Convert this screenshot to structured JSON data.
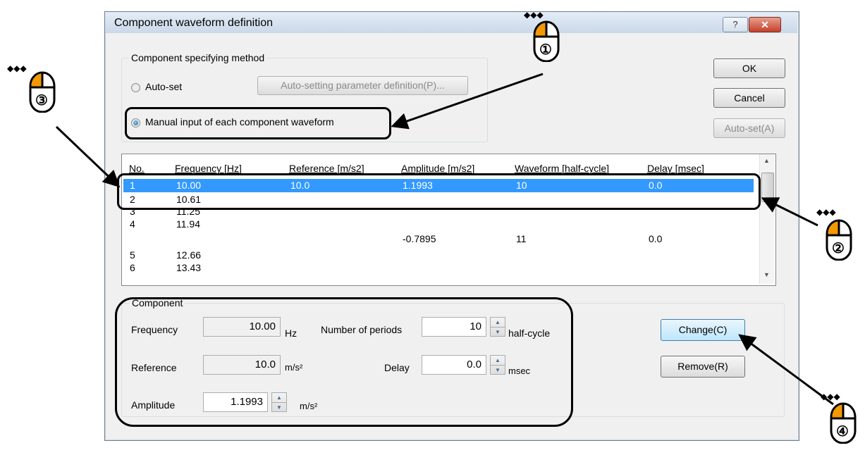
{
  "dialog": {
    "title": "Component waveform definition",
    "help_label": "?",
    "close_label": "✕"
  },
  "method_group": {
    "legend": "Component specifying method",
    "auto_set_label": "Auto-set",
    "auto_param_button": "Auto-setting parameter definition(P)...",
    "manual_label": "Manual input of each component waveform"
  },
  "buttons": {
    "ok": "OK",
    "cancel": "Cancel",
    "auto_set": "Auto-set(A)",
    "change": "Change(C)",
    "remove": "Remove(R)"
  },
  "table": {
    "columns": [
      "No.",
      "Frequency [Hz]",
      "Reference [m/s2]",
      "Amplitude [m/s2]",
      "Waveform [half-cycle]",
      "Delay [msec]"
    ],
    "rows": [
      {
        "no": "1",
        "freq": "10.00",
        "ref": "10.0",
        "amp": "1.1993",
        "wave": "10",
        "delay": "0.0"
      },
      {
        "no": "2",
        "freq": "10.61",
        "ref": "",
        "amp": "",
        "wave": "",
        "delay": ""
      },
      {
        "no": "3",
        "freq": "11.25",
        "ref": "",
        "amp": "",
        "wave": "",
        "delay": ""
      },
      {
        "no": "4",
        "freq": "11.94",
        "ref": "",
        "amp": "-0.7895",
        "wave": "11",
        "delay": "0.0"
      },
      {
        "no": "5",
        "freq": "12.66",
        "ref": "",
        "amp": "",
        "wave": "",
        "delay": ""
      },
      {
        "no": "6",
        "freq": "13.43",
        "ref": "",
        "amp": "",
        "wave": "",
        "delay": ""
      }
    ]
  },
  "component": {
    "legend": "Component",
    "frequency_label": "Frequency",
    "frequency_value": "10.00",
    "frequency_unit": "Hz",
    "periods_label": "Number of periods",
    "periods_value": "10",
    "periods_unit": "half-cycle",
    "reference_label": "Reference",
    "reference_value": "10.0",
    "reference_unit": "m/s²",
    "delay_label": "Delay",
    "delay_value": "0.0",
    "delay_unit": "msec",
    "amplitude_label": "Amplitude",
    "amplitude_value": "1.1993",
    "amplitude_unit": "m/s²"
  },
  "annotations": {
    "step1": "①",
    "step2": "②",
    "step3": "③",
    "step4": "④",
    "sparkle": "◆◆◆"
  },
  "colors": {
    "mouse_button": "#f39800",
    "selection": "#3399ff"
  }
}
